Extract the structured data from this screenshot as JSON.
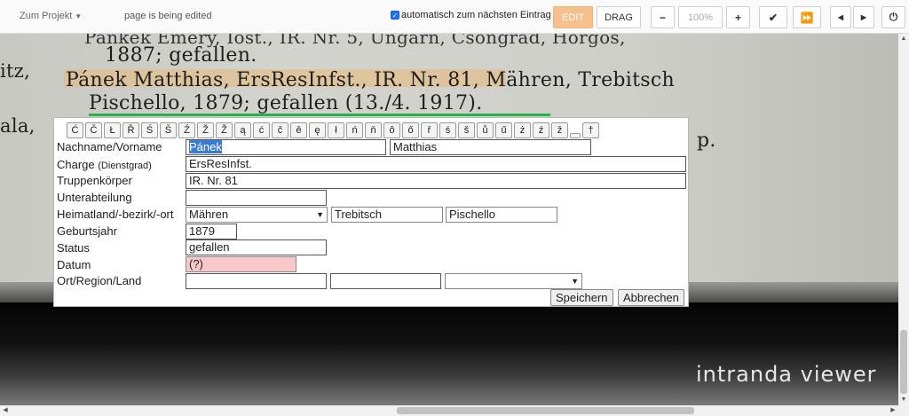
{
  "toolbar": {
    "project_label": "Zum Projekt",
    "status_text": "page is being edited",
    "auto_next_label": "automatisch zum nächsten Eintrag",
    "auto_next_checked": true,
    "edit_label": "EDIT",
    "drag_label": "DRAG",
    "zoom_out_icon": "minus-icon",
    "zoom_value": "100%",
    "zoom_in_icon": "plus-icon",
    "accent_color": "#f5c08e"
  },
  "scan": {
    "lines": [
      "1887; gefallen.",
      "Pánek Matthias, ErsResInfst., IR. Nr. 81, Mähren, Trebitsch",
      "Pischello, 1879; gefallen (13./4. 1917).",
      "p."
    ],
    "left_fragments": [
      "itz,",
      "ala,"
    ],
    "brand": "intranda viewer"
  },
  "special_chars": [
    "Ć",
    "Č",
    "Ł",
    "Ř",
    "Ś",
    "Š",
    "Ź",
    "Ž",
    "Ž",
    "ą",
    "ć",
    "č",
    "ě",
    "ę",
    "ł",
    "ń",
    "ň",
    "ô",
    "ő",
    "ř",
    "ś",
    "š",
    "ů",
    "ű",
    "ż",
    "ź",
    "ž",
    "␣",
    "†"
  ],
  "form": {
    "nachname_label": "Nachname/Vorname",
    "nachname": "Pánek",
    "vorname": "Matthias",
    "charge_label": "Charge",
    "charge_sub": "(Dienstgrad)",
    "charge": "ErsResInfst.",
    "truppe_label": "Truppenkörper",
    "truppe": "IR. Nr. 81",
    "unter_label": "Unterabteilung",
    "unter": "",
    "heimat_label": "Heimatland/-bezirk/-ort",
    "heimatland": "Mähren",
    "bezirk": "Trebitsch",
    "ort": "Pischello",
    "geburt_label": "Geburtsjahr",
    "geburt": "1879",
    "status_label": "Status",
    "status": "gefallen",
    "datum_label": "Datum",
    "datum": "(?)",
    "ortreg_label": "Ort/Region/Land",
    "ortreg1": "",
    "ortreg2": "",
    "ortreg3": "",
    "save_label": "Speichern",
    "cancel_label": "Abbrechen"
  }
}
